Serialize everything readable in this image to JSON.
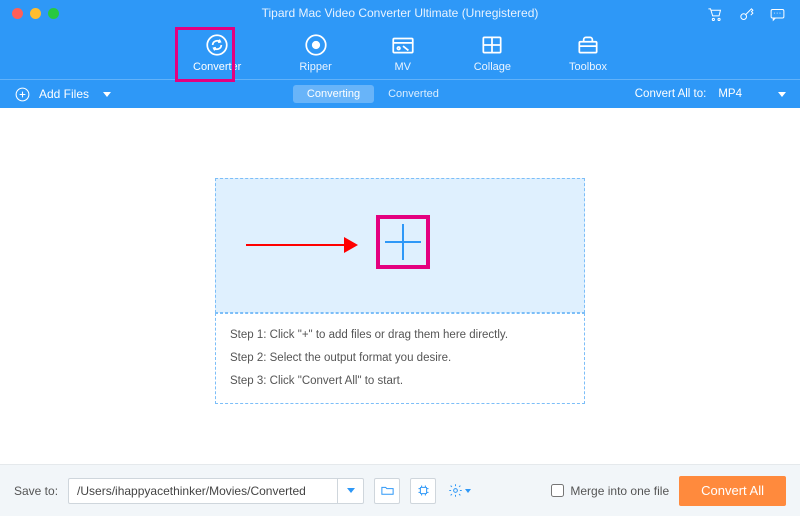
{
  "window": {
    "title": "Tipard Mac Video Converter Ultimate (Unregistered)"
  },
  "system_icons": [
    "cart-icon",
    "key-icon",
    "chat-icon"
  ],
  "tabs": [
    {
      "id": "converter",
      "label": "Converter",
      "active": true
    },
    {
      "id": "ripper",
      "label": "Ripper",
      "active": false
    },
    {
      "id": "mv",
      "label": "MV",
      "active": false
    },
    {
      "id": "collage",
      "label": "Collage",
      "active": false
    },
    {
      "id": "toolbox",
      "label": "Toolbox",
      "active": false
    }
  ],
  "toolbar": {
    "add_files_label": "Add Files",
    "segments": [
      {
        "label": "Converting",
        "active": true
      },
      {
        "label": "Converted",
        "active": false
      }
    ],
    "convert_all_to_label": "Convert All to:",
    "format_selected": "MP4"
  },
  "dropzone": {
    "step1": "Step 1: Click \"+\" to add files or drag them here directly.",
    "step2": "Step 2: Select the output format you desire.",
    "step3": "Step 3: Click \"Convert All\" to start."
  },
  "footer": {
    "save_to_label": "Save to:",
    "path": "/Users/ihappyacethinker/Movies/Converted",
    "merge_label": "Merge into one file",
    "convert_btn_label": "Convert All"
  },
  "annotations": {
    "highlight_active_tab": true,
    "highlight_plus": true,
    "arrow_to_plus": true
  },
  "colors": {
    "accent": "#2e98f7",
    "highlight": "#e4007f",
    "cta": "#ff8a3d"
  }
}
